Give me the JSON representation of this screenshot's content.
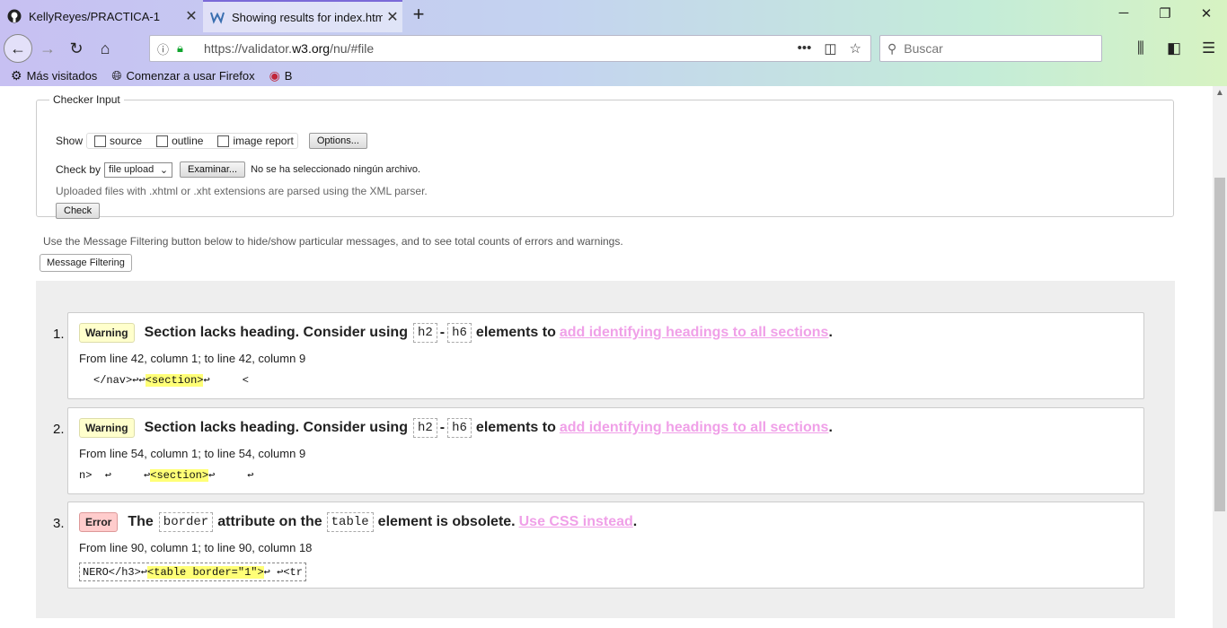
{
  "browser": {
    "tabs": [
      {
        "label": "KellyReyes/PRACTICA-1",
        "icon": "github-icon"
      },
      {
        "label": "Showing results for index.html",
        "icon": "w3c-icon"
      }
    ],
    "url_prefix": "https://validator.",
    "url_domain": "w3.org",
    "url_suffix": "/nu/#file",
    "search_placeholder": "Buscar",
    "bookmarks": [
      {
        "label": "Más visitados",
        "icon": "gear-icon"
      },
      {
        "label": "Comenzar a usar Firefox",
        "icon": "globe-icon"
      },
      {
        "label": "B",
        "icon": "flag-icon"
      }
    ]
  },
  "checker": {
    "legend": "Checker Input",
    "show_label": "Show",
    "options": [
      "source",
      "outline",
      "image report"
    ],
    "options_button": "Options...",
    "check_by_label": "Check by",
    "check_by_value": "file upload",
    "browse_button": "Examinar...",
    "no_file_text": "No se ha seleccionado ningún archivo.",
    "hint": "Uploaded files with .xhtml or .xht extensions are parsed using the XML parser.",
    "check_button": "Check"
  },
  "filter_text": "Use the Message Filtering button below to hide/show particular messages, and to see total counts of errors and warnings.",
  "filter_button": "Message Filtering",
  "messages": [
    {
      "num": "1.",
      "type": "Warning",
      "pre": "Section lacks heading. Consider using",
      "code1": "h2",
      "sep": "-",
      "code2": "h6",
      "mid": "elements to",
      "link": "add identifying headings to all sections",
      "end": ".",
      "location": "From line 42, column 1; to line 42, column 9",
      "extract_pre": "</nav>↩↩",
      "extract_hl": "<section>",
      "extract_post": "↩     <"
    },
    {
      "num": "2.",
      "type": "Warning",
      "pre": "Section lacks heading. Consider using",
      "code1": "h2",
      "sep": "-",
      "code2": "h6",
      "mid": "elements to",
      "link": "add identifying headings to all sections",
      "end": ".",
      "location": "From line 54, column 1; to line 54, column 9",
      "extract_pre": "n>  ↩     ↩",
      "extract_hl": "<section>",
      "extract_post": "↩     ↩"
    },
    {
      "num": "3.",
      "type": "Error",
      "pre": "The",
      "code1": "border",
      "mid": "attribute on the",
      "code2": "table",
      "post": "element is obsolete.",
      "link": "Use CSS instead",
      "end": ".",
      "location": "From line 90, column 1; to line 90, column 18",
      "extract_pre": "NERO</h3>↩",
      "extract_hl": "<table border=\"1\">",
      "extract_post": "↩ ↩<tr"
    }
  ]
}
